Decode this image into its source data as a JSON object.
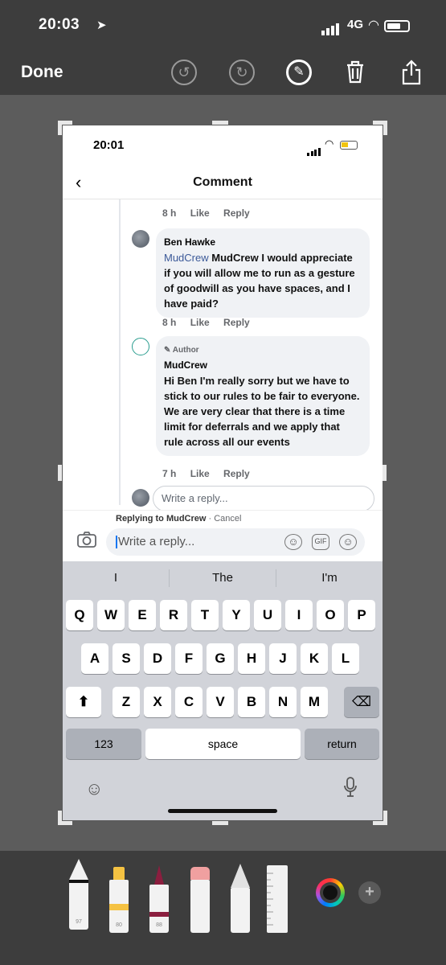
{
  "outer_status": {
    "time": "20:03",
    "network": "4G"
  },
  "markup_toolbar": {
    "done_label": "Done",
    "icons": [
      "undo-icon",
      "redo-icon",
      "pen-tool-icon",
      "trash-icon",
      "share-icon"
    ]
  },
  "screenshot": {
    "status_time": "20:01",
    "header": {
      "title": "Comment",
      "back_icon": "chevron-left-icon"
    },
    "comments": [
      {
        "time": "8 h",
        "like": "Like",
        "reply": "Reply"
      },
      {
        "name": "Ben Hawke",
        "tag": "MudCrew",
        "text": " MudCrew I would appreciate if you will allow me to run as a gesture of goodwill as you have spaces, and I have paid?",
        "time": "8 h",
        "like": "Like",
        "reply": "Reply"
      },
      {
        "badge": "Author",
        "name": "MudCrew",
        "text": "Hi Ben I'm really sorry but we have to stick to our rules to be fair to everyone. We are very clear that there is a time limit for deferrals and we apply that rule across all our events",
        "time": "7 h",
        "like": "Like",
        "reply": "Reply"
      }
    ],
    "reply_preview_placeholder": "Write a reply...",
    "replying_to": {
      "prefix": "Replying to ",
      "name": "MudCrew",
      "separator": " · ",
      "cancel": "Cancel"
    },
    "reply_input_placeholder": "Write a reply...",
    "input_icons": {
      "sticker": "sticker-icon",
      "gif": "GIF",
      "emoji": "emoji-icon"
    },
    "keyboard": {
      "suggestions": [
        "I",
        "The",
        "I'm"
      ],
      "row1": [
        "Q",
        "W",
        "E",
        "R",
        "T",
        "Y",
        "U",
        "I",
        "O",
        "P"
      ],
      "row2": [
        "A",
        "S",
        "D",
        "F",
        "G",
        "H",
        "J",
        "K",
        "L"
      ],
      "row3": [
        "Z",
        "X",
        "C",
        "V",
        "B",
        "N",
        "M"
      ],
      "numbers_label": "123",
      "space_label": "space",
      "return_label": "return"
    }
  },
  "tools": {
    "items": [
      {
        "name": "pen",
        "label": "97"
      },
      {
        "name": "highlighter",
        "label": "80",
        "color": "#f5c242"
      },
      {
        "name": "marker",
        "label": "88",
        "color": "#8b1e3f"
      },
      {
        "name": "eraser",
        "color": "#f0a0a0"
      },
      {
        "name": "lasso"
      },
      {
        "name": "ruler"
      }
    ],
    "accent": "#3d3d3d"
  }
}
